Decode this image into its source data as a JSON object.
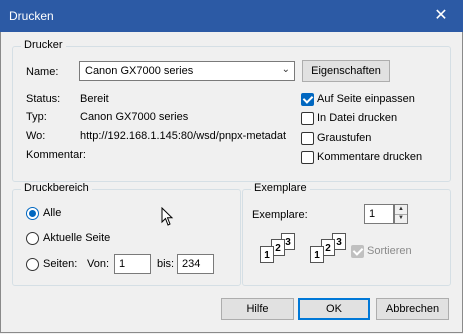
{
  "window": {
    "title": "Drucken",
    "close_icon": "close-icon"
  },
  "printer": {
    "group_label": "Drucker",
    "name_label": "Name:",
    "name_value": "Canon GX7000 series",
    "properties_button": "Eigenschaften",
    "status_label": "Status:",
    "status_value": "Bereit",
    "type_label": "Typ:",
    "type_value": "Canon GX7000 series",
    "where_label": "Wo:",
    "where_value": "http://192.168.1.145:80/wsd/pnpx-metadat",
    "comment_label": "Kommentar:",
    "comment_value": ""
  },
  "options": {
    "fit_page": {
      "label": "Auf Seite einpassen",
      "checked": true
    },
    "print_to_file": {
      "label": "In Datei drucken",
      "checked": false
    },
    "grayscale": {
      "label": "Graustufen",
      "checked": false
    },
    "print_comments": {
      "label": "Kommentare drucken",
      "checked": false
    }
  },
  "range": {
    "group_label": "Druckbereich",
    "all": {
      "label": "Alle",
      "checked": true
    },
    "current": {
      "label": "Aktuelle Seite",
      "checked": false
    },
    "pages": {
      "label": "Seiten:",
      "checked": false
    },
    "from_label": "Von:",
    "from_value": "1",
    "to_label": "bis:",
    "to_value": "234"
  },
  "copies": {
    "group_label": "Exemplare",
    "count_label": "Exemplare:",
    "count_value": "1",
    "collate": {
      "label": "Sortieren",
      "checked": true,
      "enabled": false
    },
    "page_numbers": [
      "1",
      "2",
      "3"
    ]
  },
  "buttons": {
    "help": "Hilfe",
    "ok": "OK",
    "cancel": "Abbrechen"
  },
  "colors": {
    "titlebar": "#2c5aa5",
    "accent": "#0067c0",
    "default_button_border": "#0078d7"
  }
}
